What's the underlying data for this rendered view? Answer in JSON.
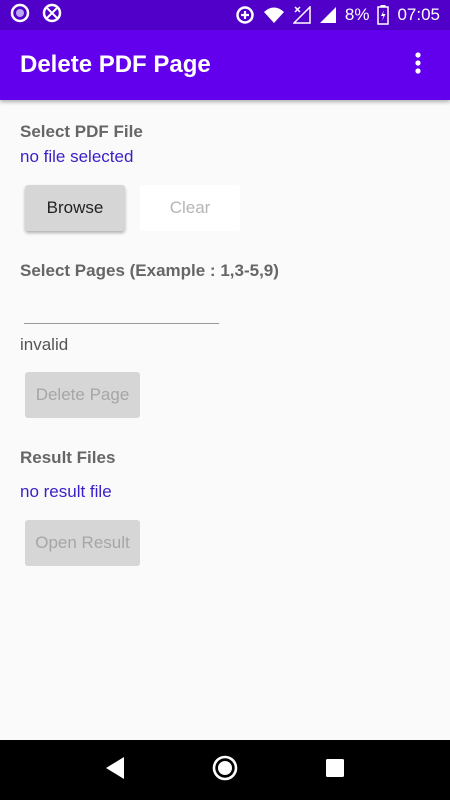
{
  "status_bar": {
    "battery_percent": "8%",
    "time": "07:05",
    "left_icons": [
      "circle-icon",
      "cancel-circle-icon"
    ],
    "right_icons": [
      "data-saver-icon",
      "wifi-icon",
      "signal-no-data-icon",
      "signal-icon",
      "battery-charging-icon"
    ]
  },
  "app_bar": {
    "title": "Delete PDF Page",
    "menu_icon": "more-vert-icon"
  },
  "pdf_section": {
    "label": "Select PDF File",
    "file_status": "no file selected",
    "browse_label": "Browse",
    "clear_label": "Clear"
  },
  "pages_section": {
    "label": "Select Pages (Example : 1,3-5,9)",
    "input_value": "",
    "validation_text": "invalid",
    "delete_label": "Delete Page"
  },
  "result_section": {
    "label": "Result Files",
    "result_status": "no result file",
    "open_label": "Open Result"
  },
  "nav_bar": {
    "icons": [
      "back-icon",
      "home-icon",
      "recents-icon"
    ]
  },
  "colors": {
    "status_bar": "#5000c8",
    "app_bar": "#6200ee",
    "link_text": "#3a1fc8",
    "background": "#fafafa"
  }
}
